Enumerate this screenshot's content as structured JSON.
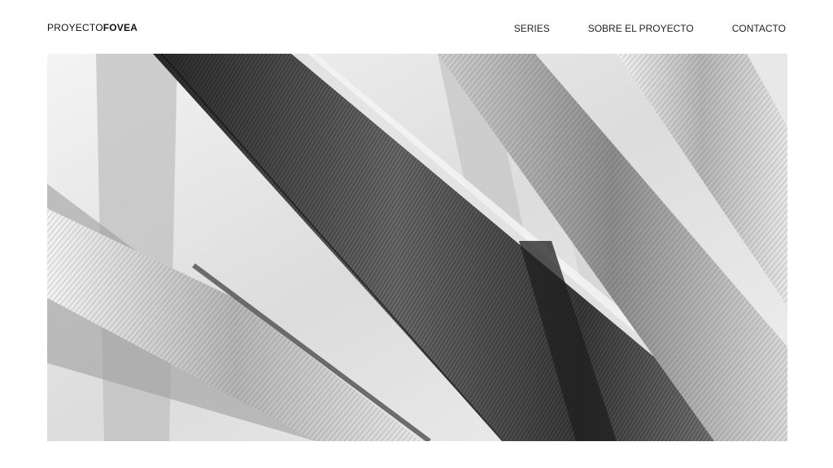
{
  "brand": {
    "prefix": "PROYECTO",
    "suffix": "FOVEA"
  },
  "nav": {
    "items": [
      {
        "label": "SERIES"
      },
      {
        "label": "SOBRE EL PROYECTO"
      },
      {
        "label": "CONTACTO"
      }
    ]
  },
  "hero": {
    "subject": "black-and-white close-up photograph of palm leaves"
  },
  "colors": {
    "background": "#ffffff",
    "text": "#111111"
  }
}
